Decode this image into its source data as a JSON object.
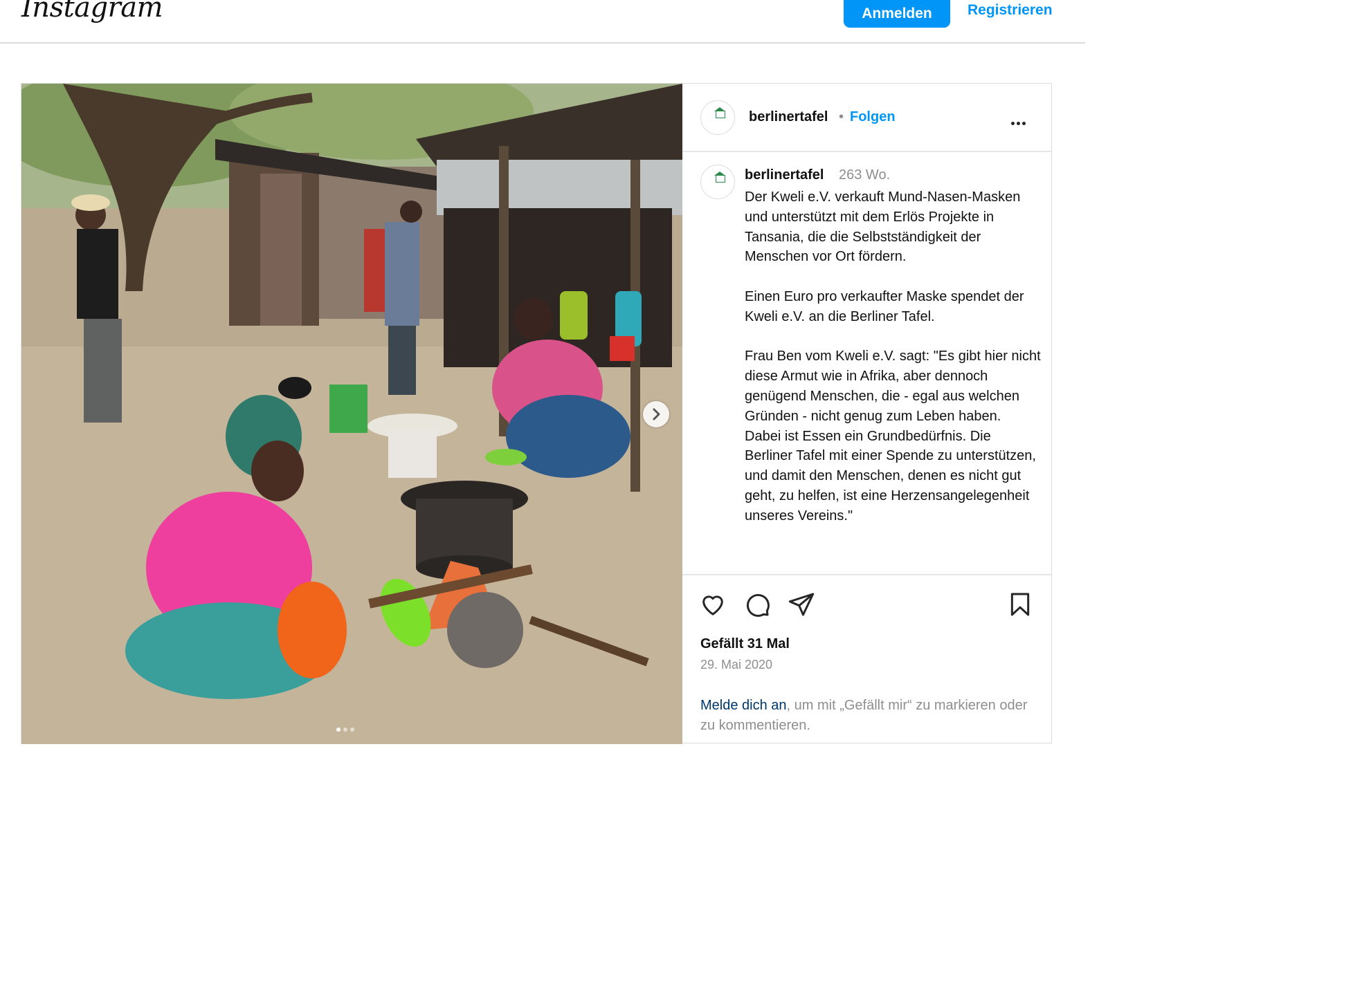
{
  "app": {
    "logo": "Instagram"
  },
  "topbar": {
    "login_label": "Anmelden",
    "register_label": "Registrieren"
  },
  "post": {
    "username": "berlinertafel",
    "separator": "•",
    "follow_label": "Folgen",
    "more_icon": "more-horizontal-icon",
    "avatar_text": "BERLINER TAFEL E.V.",
    "media": {
      "slide_count": 3,
      "current_slide": 1,
      "next_icon": "chevron-right-icon"
    },
    "caption": {
      "username": "berlinertafel",
      "time": "263 Wo.",
      "text": "Der Kweli e.V. verkauft Mund-Nasen-Masken und unterstützt mit dem Erlös Projekte in Tansania, die die Selbstständigkeit der Menschen vor Ort fördern.\n\nEinen Euro pro verkaufter Maske spendet der Kweli e.V. an die Berliner Tafel.\n\nFrau Ben vom Kweli e.V. sagt: \"Es gibt hier nicht diese Armut wie in Afrika, aber dennoch genügend Menschen, die - egal aus welchen Gründen - nicht genug zum Leben haben.\nDabei ist Essen ein Grundbedürfnis. Die Berliner Tafel mit einer Spende zu unterstützen, und damit den Menschen, denen es nicht gut geht, zu helfen, ist eine Herzensangelegenheit unseres Vereins.\""
    },
    "actions": {
      "icons": [
        "heart-icon",
        "comment-icon",
        "share-icon",
        "bookmark-icon"
      ],
      "likes": "Gefällt 31 Mal",
      "date": "29. Mai 2020",
      "login_link": "Melde dich an",
      "login_rest": ", um mit „Gefällt mir“ zu markieren oder zu kommentieren."
    }
  },
  "colors": {
    "accent": "#0095f6",
    "link_dark": "#00376b",
    "muted": "#8e8e8e",
    "border": "#dbdbdb"
  }
}
